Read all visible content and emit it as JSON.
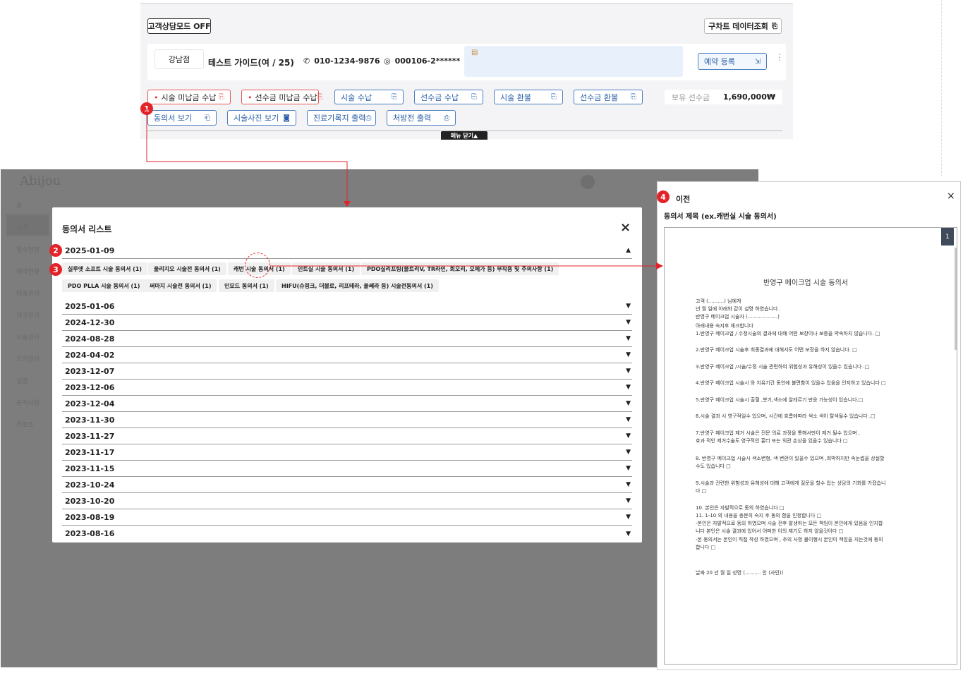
{
  "top_panel": {
    "consult_mode_btn": "고객상담모드 OFF",
    "old_chart_btn": "구차트 데이터조회",
    "branch": "강남점",
    "customer": "테스트 가이드(여 / 25)",
    "phone": "010-1234-9876",
    "id_number": "000106-2******",
    "reserve_btn": "예약 등록",
    "payment_buttons": [
      "시술 미납금 수납",
      "선수금 미납금 수납",
      "시술 수납",
      "선수금 수납",
      "시술 환불",
      "선수금 환불"
    ],
    "prepaid_label": "보유 선수금",
    "prepaid_value": "1,690,000₩",
    "action_buttons": [
      "동의서 보기",
      "시술사진 보기",
      "진료기록지 출력",
      "처방전 출력"
    ],
    "close_menu": "메뉴 닫기▲"
  },
  "markers": [
    "1",
    "2",
    "3",
    "4"
  ],
  "background_app": {
    "logo": "Abijou",
    "nav_items": [
      "홈",
      "고객",
      "접수현황",
      "예약현황",
      "매출관리",
      "재고관리",
      "시술관리",
      "고객관리",
      "설정",
      "공지사항",
      "리포트"
    ]
  },
  "modal": {
    "title": "동의서 리스트",
    "close": "×",
    "expanded_date": "2025-01-09",
    "chips": [
      "실루엣 소프트 시술 동의서   (1)",
      "울리지오 시술전 동의서   (1)",
      "캐번 시술 동의서   (1)",
      "인트실 시술 동의서   (1)",
      "PDO실리프팅(블트리V, TR라인, 회오리, 오메가 등) 부작용 및 주의사항   (1)",
      "PDO PLLA 시술 동의서   (1)",
      "써마지 시술전 동의서   (1)",
      "인모드 동의서   (1)",
      "HIFU(슈링크, 더블로, 리프테라, 울쎄라 등) 시술전동의서   (1)"
    ],
    "dates": [
      "2025-01-06",
      "2024-12-30",
      "2024-08-28",
      "2024-04-02",
      "2023-12-07",
      "2023-12-06",
      "2023-12-04",
      "2023-11-30",
      "2023-11-27",
      "2023-11-17",
      "2023-11-15",
      "2023-10-24",
      "2023-10-20",
      "2023-08-19",
      "2023-08-16"
    ]
  },
  "preview": {
    "back_label": "이전",
    "close": "×",
    "doc_title_label": "동의서 제목 (ex.캐번실 시술 동의서)",
    "page_num": "1",
    "doc_heading": "반영구 메이크업 시술 동의서",
    "doc_lines": [
      "고객 (..........) 님에게",
      "      년     월     일에 아래와 같이 설명 하였습니다 .",
      "                                          반영구 메이크업 시술자 (...................)",
      "아래내용 숙지후 체크합니다",
      "1.반영구 메이크업 / 수정시술의 결과에 대해 어떤 보장이나 보증을 약속하지 않습니다. □",
      "2.반영구 메이크업 시술후 최종결과에 대해서도 어떤 보장을 하지 않습니다. □",
      "3.반영구 메이크업 /시술/수정 시술 관련하여 위험성과 유해성이 있을수 있습니다 .□",
      "4.반영구 메이크업 시술시 와 치유기간 동안에 불편함이 있을수 있음을 인지하고 있습니다 □",
      "5.반영구 메이크업 시술시 출혈 ,붓기,색소에 알레르기 반응 가능성이 있습니다.□",
      "6.시술 결과 시 영구적일수 있으며, 시간에 흐름에따라 색소 색이 탈색될수 있습니다 .□",
      "7.반영구 메이크업 제거 시술은 전문 의료 과정을 통해서만이 제거 될수 있으며 ,",
      "효과 적인 제거수술도 영구적인 흉터 또는 외관 손상을 있을수 있습니다 □",
      "8. 반영구 메이크업 시술시 색소변형, 색 변환이 있을수 있으며 ,희박하지만 속눈썹을 상실할",
      "수도 있습니다 □",
      "9.시술과 관련한 위험성과 유해성에 대해 고객에게 질문을 할수 있는 상담의 기회를 가졌습니",
      "다 □",
      "10. 본인은 자발적으로 동의 하였습니다 □",
      "11. 1-10 의 내용을 충분히 숙지 후 동의 함을 인정합니다 □",
      "-본인은 자발적으로 동의 하였으며 시술 전후 발생하는 모든 책임이 본인에게 있음을 인지합",
      "니다 본인은 시술 결과에 있어서 어떠한 이의 제기도 하지 않을것이다 □",
      "-본 동의서는 본인이 직접 작성 하였으며 , 추의 사항 불이행시 본인이 책임을 지는것에 동의",
      "합니다 □",
      "날짜 20   년    월    일                   성명 (..........  인 (사인))"
    ]
  },
  "colors": {
    "accent_red": "#e3232a",
    "accent_blue": "#2a5ea8",
    "overlay_grey": "#7d7d7d"
  }
}
